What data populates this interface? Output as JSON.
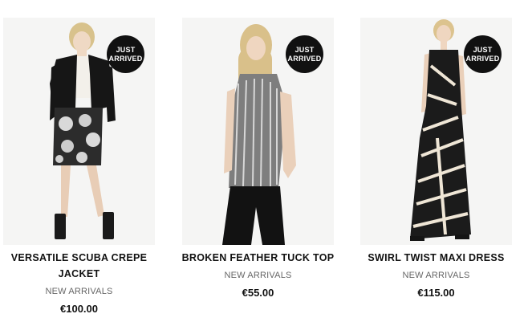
{
  "products": [
    {
      "name_line1": "VERSATILE SCUBA CREPE",
      "name_line2": "JACKET",
      "category": "NEW ARRIVALS",
      "price": "€100.00",
      "badge_line1": "JUST",
      "badge_line2": "ARRIVED"
    },
    {
      "name_line1": "BROKEN FEATHER TUCK TOP",
      "category": "NEW ARRIVALS",
      "price": "€55.00",
      "badge_line1": "JUST",
      "badge_line2": "ARRIVED"
    },
    {
      "name_line1": "SWIRL TWIST MAXI DRESS",
      "category": "NEW ARRIVALS",
      "price": "€115.00",
      "badge_line1": "JUST",
      "badge_line2": "ARRIVED"
    }
  ],
  "colors": {
    "badge_bg": "#111111",
    "text": "#111111",
    "muted": "#666666",
    "photo_bg": "#f5f5f4"
  }
}
